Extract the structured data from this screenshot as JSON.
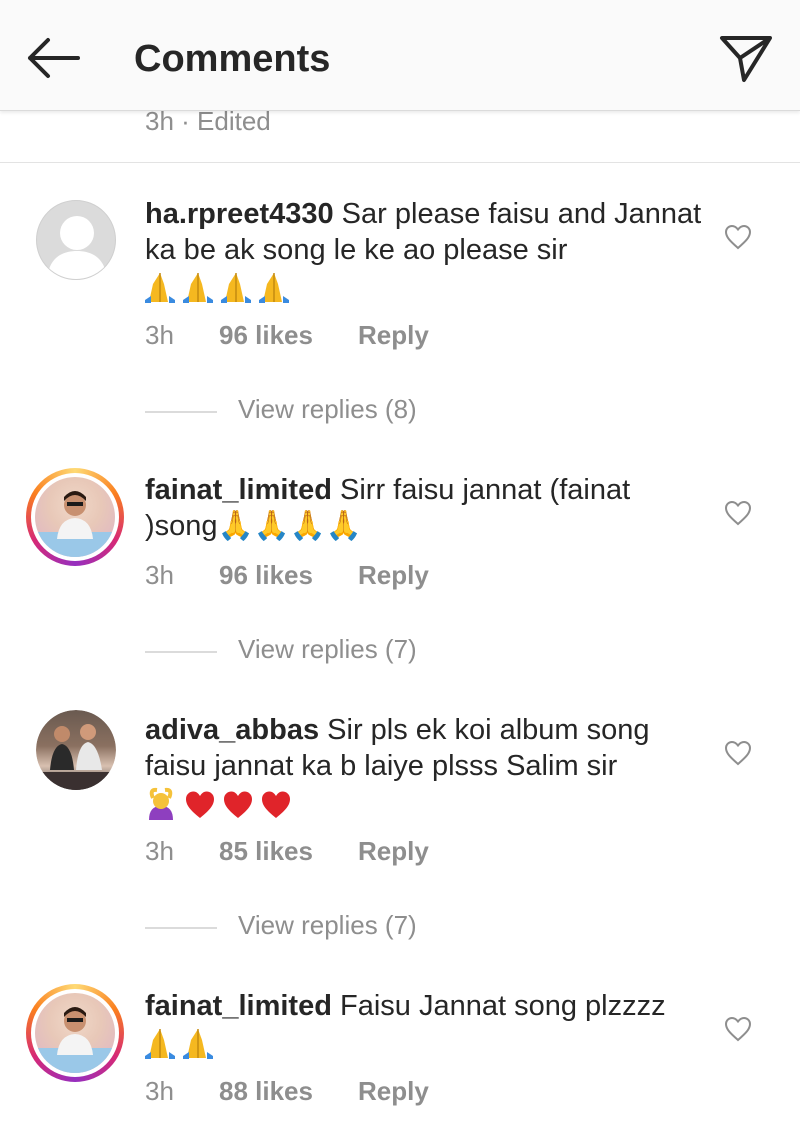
{
  "header": {
    "title": "Comments",
    "back_icon": "arrow-left-icon",
    "send_icon": "paper-plane-icon"
  },
  "previous_comment": {
    "meta": "3h · Edited"
  },
  "comments": [
    {
      "username": "ha.rpreet4330",
      "text": " Sar please faisu and Jannat ka be ak song le ke ao please sir",
      "emojis": "🙏🙏🙏🙏",
      "time": "3h",
      "likes": "96 likes",
      "reply": "Reply",
      "view_replies": "View replies (8)"
    },
    {
      "username": "fainat_limited",
      "text": " Sirr  faisu jannat (fainat )song🙏🙏🙏🙏",
      "time": "3h",
      "likes": "96 likes",
      "reply": "Reply",
      "view_replies": "View replies (7)"
    },
    {
      "username": "adiva_abbas",
      "text": " Sir pls ek koi album song faisu jannat ka b laiye plsss Salim sir",
      "emojis": "🙆❤❤❤",
      "time": "3h",
      "likes": "85 likes",
      "reply": "Reply",
      "view_replies": "View replies (7)"
    },
    {
      "username": "fainat_limited",
      "text": " Faisu Jannat song plzzzz",
      "emojis": "🙏🙏",
      "time": "3h",
      "likes": "88 likes",
      "reply": "Reply"
    }
  ],
  "colors": {
    "text": "#262626",
    "secondary": "#8e8e8e",
    "header_bg": "#fafafa",
    "story_ring": [
      "#feda75",
      "#fa7e1e",
      "#d62976",
      "#962fbf"
    ],
    "pray_emoji": "#f5b820",
    "heart_emoji": "#e0242a"
  }
}
